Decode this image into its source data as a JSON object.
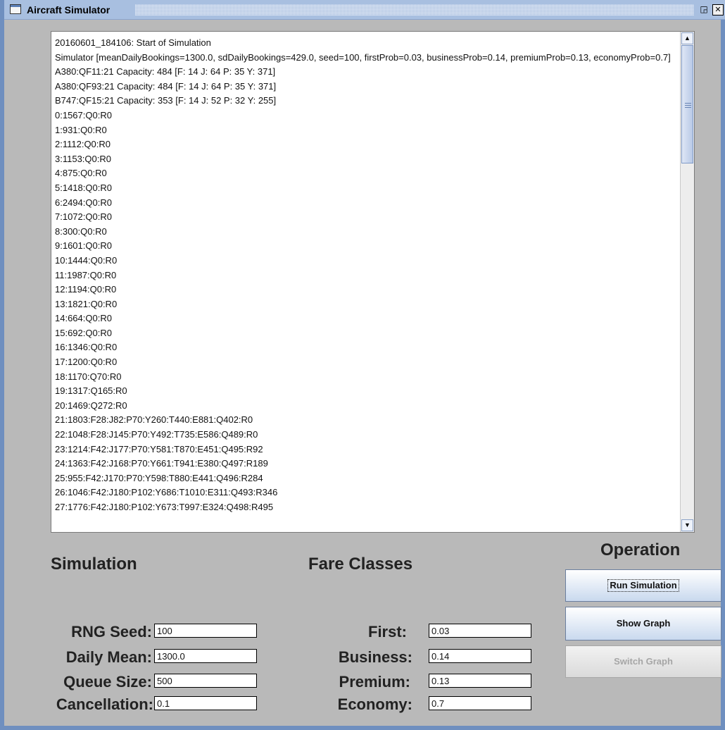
{
  "window": {
    "title": "Aircraft Simulator",
    "restore_glyph": "◲",
    "close_glyph": "✕"
  },
  "log": {
    "text": "20160601_184106: Start of Simulation\nSimulator [meanDailyBookings=1300.0, sdDailyBookings=429.0, seed=100, firstProb=0.03, businessProb=0.14, premiumProb=0.13, economyProb=0.7]\nA380:QF11:21 Capacity: 484 [F: 14 J: 64 P: 35 Y: 371]\nA380:QF93:21 Capacity: 484 [F: 14 J: 64 P: 35 Y: 371]\nB747:QF15:21 Capacity: 353 [F: 14 J: 52 P: 32 Y: 255]\n0:1567:Q0:R0\n1:931:Q0:R0\n2:1112:Q0:R0\n3:1153:Q0:R0\n4:875:Q0:R0\n5:1418:Q0:R0\n6:2494:Q0:R0\n7:1072:Q0:R0\n8:300:Q0:R0\n9:1601:Q0:R0\n10:1444:Q0:R0\n11:1987:Q0:R0\n12:1194:Q0:R0\n13:1821:Q0:R0\n14:664:Q0:R0\n15:692:Q0:R0\n16:1346:Q0:R0\n17:1200:Q0:R0\n18:1170:Q70:R0\n19:1317:Q165:R0\n20:1469:Q272:R0\n21:1803:F28:J82:P70:Y260:T440:E881:Q402:R0\n22:1048:F28:J145:P70:Y492:T735:E586:Q489:R0\n23:1214:F42:J177:P70:Y581:T870:E451:Q495:R92\n24:1363:F42:J168:P70:Y661:T941:E380:Q497:R189\n25:955:F42:J170:P70:Y598:T880:E441:Q496:R284\n26:1046:F42:J180:P102:Y686:T1010:E311:Q493:R346\n27:1776:F42:J180:P102:Y673:T997:E324:Q498:R495",
    "scroll_up": "▲",
    "scroll_down": "▼"
  },
  "simulation": {
    "heading": "Simulation",
    "rng_seed_label": "RNG Seed:",
    "rng_seed_value": "100",
    "daily_mean_label": "Daily Mean:",
    "daily_mean_value": "1300.0",
    "queue_size_label": "Queue Size:",
    "queue_size_value": "500",
    "cancellation_label": "Cancellation:",
    "cancellation_value": "0.1"
  },
  "fare_classes": {
    "heading": "Fare Classes",
    "first_label": "First:",
    "first_value": "0.03",
    "business_label": "Business:",
    "business_value": "0.14",
    "premium_label": "Premium:",
    "premium_value": "0.13",
    "economy_label": "Economy:",
    "economy_value": "0.7"
  },
  "operation": {
    "heading": "Operation",
    "run_label": "Run Simulation",
    "show_graph_label": "Show Graph",
    "switch_graph_label": "Switch Graph"
  }
}
